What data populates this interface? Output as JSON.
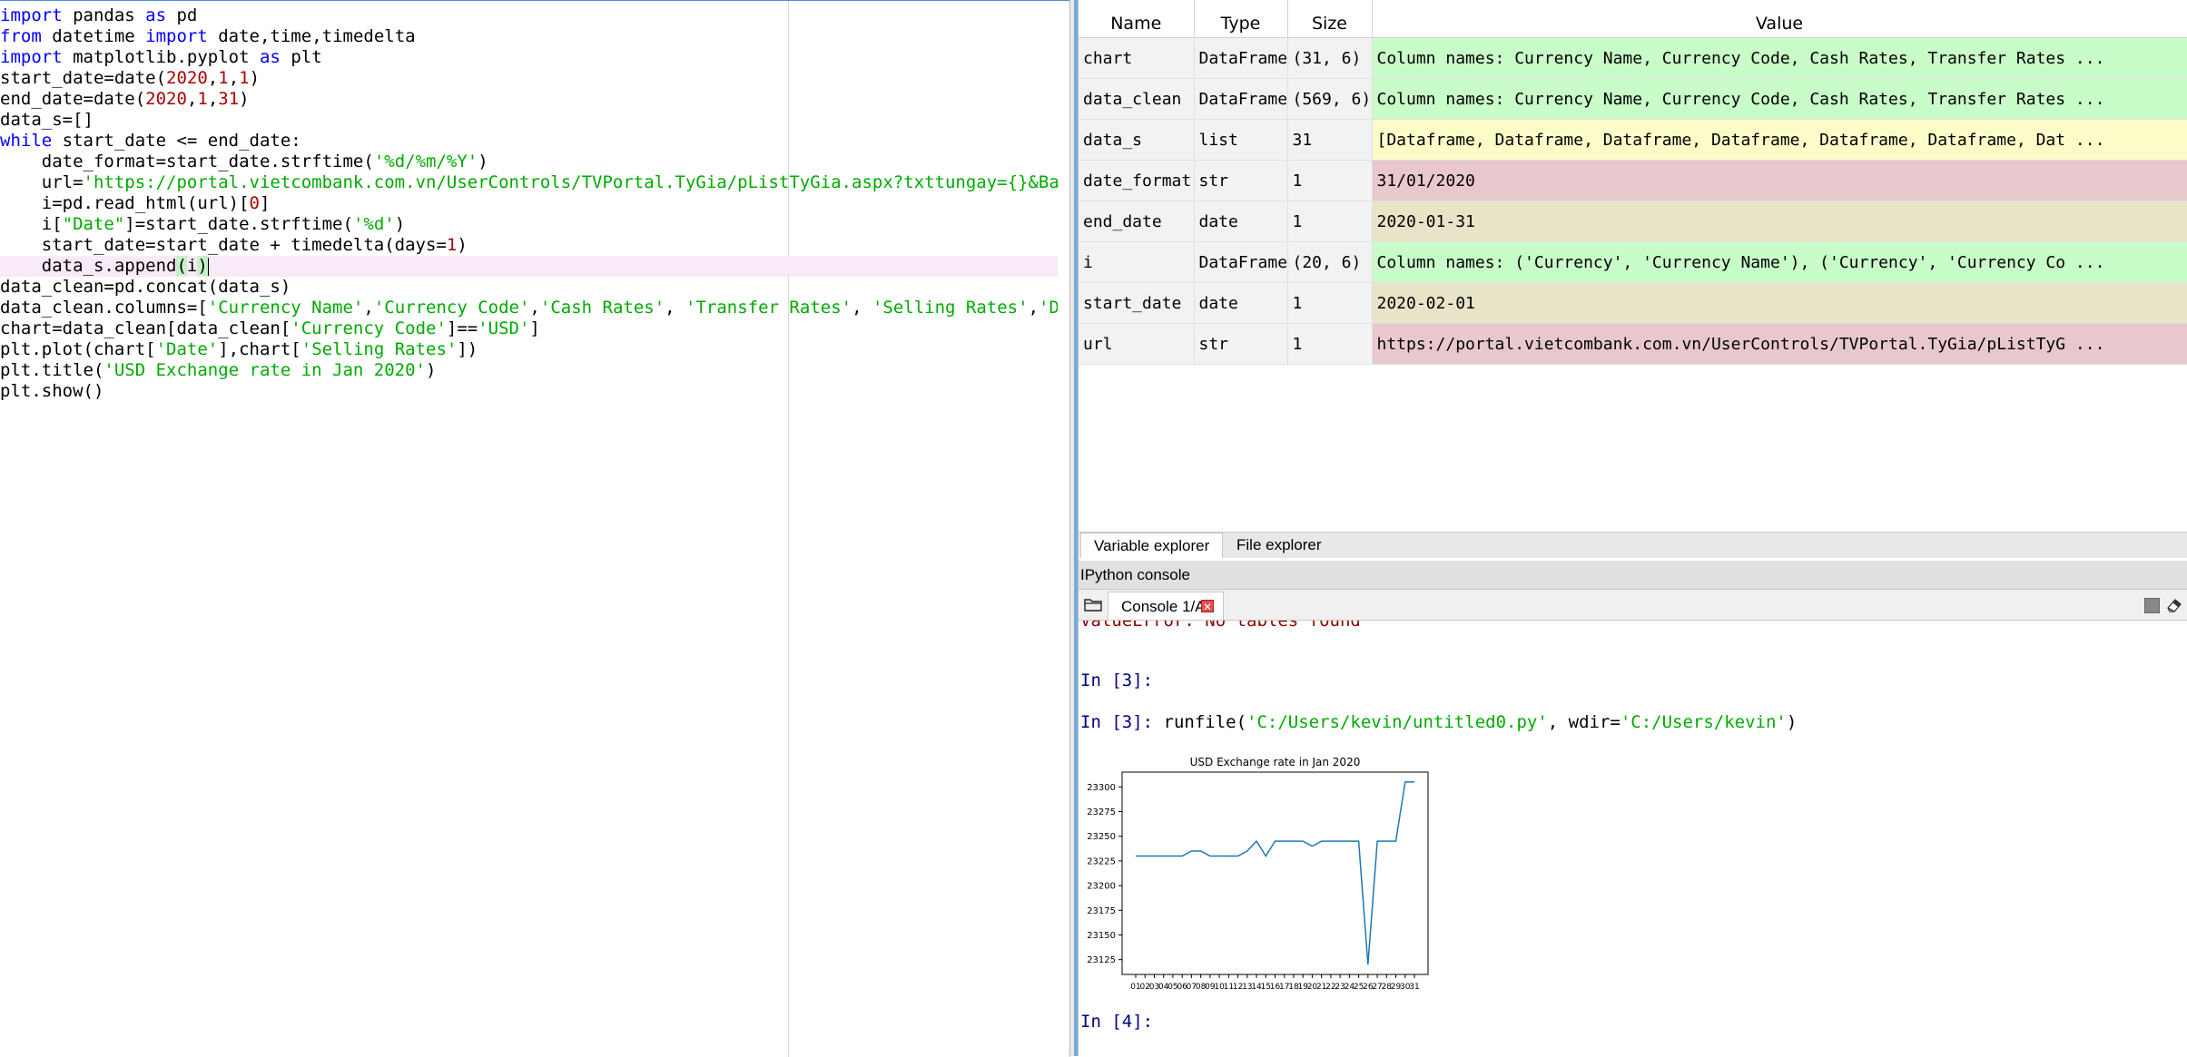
{
  "editor": {
    "lines": [
      {
        "parts": [
          {
            "t": "import",
            "c": "kw"
          },
          {
            "t": " pandas "
          },
          {
            "t": "as",
            "c": "kw"
          },
          {
            "t": " pd"
          }
        ]
      },
      {
        "parts": [
          {
            "t": "from",
            "c": "kw"
          },
          {
            "t": " datetime "
          },
          {
            "t": "import",
            "c": "kw"
          },
          {
            "t": " date,time,timedelta"
          }
        ]
      },
      {
        "parts": [
          {
            "t": "import",
            "c": "kw"
          },
          {
            "t": " matplotlib.pyplot "
          },
          {
            "t": "as",
            "c": "kw"
          },
          {
            "t": " plt"
          }
        ]
      },
      {
        "parts": [
          {
            "t": "start_date=date("
          },
          {
            "t": "2020",
            "c": "num"
          },
          {
            "t": ","
          },
          {
            "t": "1",
            "c": "num"
          },
          {
            "t": ","
          },
          {
            "t": "1",
            "c": "num"
          },
          {
            "t": ")"
          }
        ]
      },
      {
        "parts": [
          {
            "t": "end_date=date("
          },
          {
            "t": "2020",
            "c": "num"
          },
          {
            "t": ","
          },
          {
            "t": "1",
            "c": "num"
          },
          {
            "t": ","
          },
          {
            "t": "31",
            "c": "num"
          },
          {
            "t": ")"
          }
        ]
      },
      {
        "parts": [
          {
            "t": "data_s=[]"
          }
        ]
      },
      {
        "parts": [
          {
            "t": "while",
            "c": "kw"
          },
          {
            "t": " start_date <= end_date:"
          }
        ]
      },
      {
        "parts": [
          {
            "t": "    date_format=start_date.strftime("
          },
          {
            "t": "'%d/%m/%Y'",
            "c": "str"
          },
          {
            "t": ")"
          }
        ]
      },
      {
        "parts": [
          {
            "t": "    url="
          },
          {
            "t": "'https://portal.vietcombank.com.vn/UserControls/TVPortal.TyGia/pListTyGia.aspx?txttungay={}&BacrhI",
            "c": "str"
          }
        ]
      },
      {
        "parts": [
          {
            "t": "    i=pd.read_html(url)["
          },
          {
            "t": "0",
            "c": "num"
          },
          {
            "t": "]"
          }
        ]
      },
      {
        "parts": [
          {
            "t": "    i["
          },
          {
            "t": "\"Date\"",
            "c": "str"
          },
          {
            "t": "]=start_date.strftime("
          },
          {
            "t": "'%d'",
            "c": "str"
          },
          {
            "t": ")"
          }
        ]
      },
      {
        "parts": [
          {
            "t": "    start_date=start_date + timedelta(days="
          },
          {
            "t": "1",
            "c": "num"
          },
          {
            "t": ")"
          }
        ]
      },
      {
        "parts": [
          {
            "t": "    data_s.append"
          },
          {
            "t": "(",
            "c": "bracket-hl"
          },
          {
            "t": "i"
          },
          {
            "t": ")",
            "c": "bracket-hl"
          },
          {
            "t": "|CURSOR|"
          }
        ],
        "current": true
      },
      {
        "parts": [
          {
            "t": "data_clean=pd.concat(data_s)"
          }
        ]
      },
      {
        "parts": [
          {
            "t": "data_clean.columns=["
          },
          {
            "t": "'Currency Name'",
            "c": "str"
          },
          {
            "t": ","
          },
          {
            "t": "'Currency Code'",
            "c": "str"
          },
          {
            "t": ","
          },
          {
            "t": "'Cash Rates'",
            "c": "str"
          },
          {
            "t": ", "
          },
          {
            "t": "'Transfer Rates'",
            "c": "str"
          },
          {
            "t": ", "
          },
          {
            "t": "'Selling Rates'",
            "c": "str"
          },
          {
            "t": ","
          },
          {
            "t": "'Date'",
            "c": "str"
          }
        ]
      },
      {
        "parts": [
          {
            "t": "chart=data_clean[data_clean["
          },
          {
            "t": "'Currency Code'",
            "c": "str"
          },
          {
            "t": "]=="
          },
          {
            "t": "'USD'",
            "c": "str"
          },
          {
            "t": "]"
          }
        ]
      },
      {
        "parts": [
          {
            "t": "plt.plot(chart["
          },
          {
            "t": "'Date'",
            "c": "str"
          },
          {
            "t": "],chart["
          },
          {
            "t": "'Selling Rates'",
            "c": "str"
          },
          {
            "t": "])"
          }
        ]
      },
      {
        "parts": [
          {
            "t": "plt.title("
          },
          {
            "t": "'USD Exchange rate in Jan 2020'",
            "c": "str"
          },
          {
            "t": ")"
          }
        ]
      },
      {
        "parts": [
          {
            "t": "plt.show()"
          }
        ]
      }
    ]
  },
  "variable_explorer": {
    "headers": {
      "name": "Name",
      "type": "Type",
      "size": "Size",
      "value": "Value"
    },
    "rows": [
      {
        "name": "chart",
        "type": "DataFrame",
        "size": "(31, 6)",
        "value": "Column names: Currency Name, Currency Code, Cash Rates, Transfer Rates ...",
        "color": "#c8fcc8"
      },
      {
        "name": "data_clean",
        "type": "DataFrame",
        "size": "(569, 6)",
        "value": "Column names: Currency Name, Currency Code, Cash Rates, Transfer Rates ...",
        "color": "#c8fcc8"
      },
      {
        "name": "data_s",
        "type": "list",
        "size": "31",
        "value": "[Dataframe, Dataframe, Dataframe, Dataframe, Dataframe, Dataframe, Dat ...",
        "color": "#fcfcc8"
      },
      {
        "name": "date_format",
        "type": "str",
        "size": "1",
        "value": "31/01/2020",
        "color": "#e8c8cc"
      },
      {
        "name": "end_date",
        "type": "date",
        "size": "1",
        "value": "2020-01-31",
        "color": "#e8e4c8"
      },
      {
        "name": "i",
        "type": "DataFrame",
        "size": "(20, 6)",
        "value": "Column names: ('Currency', 'Currency Name'), ('Currency', 'Currency Co ...",
        "color": "#c8fcc8"
      },
      {
        "name": "start_date",
        "type": "date",
        "size": "1",
        "value": "2020-02-01",
        "color": "#e8e4c8"
      },
      {
        "name": "url",
        "type": "str",
        "size": "1",
        "value": "https://portal.vietcombank.com.vn/UserControls/TVPortal.TyGia/pListTyG ...",
        "color": "#e8c8cc"
      }
    ],
    "tabs": {
      "variable_explorer": "Variable explorer",
      "file_explorer": "File explorer"
    }
  },
  "console": {
    "title": "IPython console",
    "tab_label": "Console 1/A",
    "tab_close": "✕",
    "clipped_line": "ValueError: No tables found",
    "prompt3": "In [3]:",
    "prompt3b": "In [3]:",
    "runfile_pre": " runfile(",
    "runfile_arg1": "'C:/Users/kevin/untitled0.py'",
    "runfile_mid": ", wdir=",
    "runfile_arg2": "'C:/Users/kevin'",
    "runfile_post": ")",
    "prompt4": "In [4]:"
  },
  "chart_data": {
    "type": "line",
    "title": "USD Exchange rate in Jan 2020",
    "x": [
      "01",
      "02",
      "03",
      "04",
      "05",
      "06",
      "07",
      "08",
      "09",
      "10",
      "11",
      "12",
      "13",
      "14",
      "15",
      "16",
      "17",
      "18",
      "19",
      "20",
      "21",
      "22",
      "23",
      "24",
      "25",
      "26",
      "27",
      "28",
      "29",
      "30",
      "31"
    ],
    "series": [
      {
        "values": [
          23230,
          23230,
          23230,
          23230,
          23230,
          23230,
          23235,
          23235,
          23230,
          23230,
          23230,
          23230,
          23235,
          23245,
          23230,
          23245,
          23245,
          23245,
          23245,
          23240,
          23245,
          23245,
          23245,
          23245,
          23245,
          23120,
          23245,
          23245,
          23245,
          23305,
          23305
        ],
        "color": "#1f77b4"
      }
    ],
    "xlabel": "",
    "ylabel": "",
    "yticks": [
      23125,
      23150,
      23175,
      23200,
      23225,
      23250,
      23275,
      23300
    ],
    "ylim": [
      23110,
      23315
    ]
  }
}
